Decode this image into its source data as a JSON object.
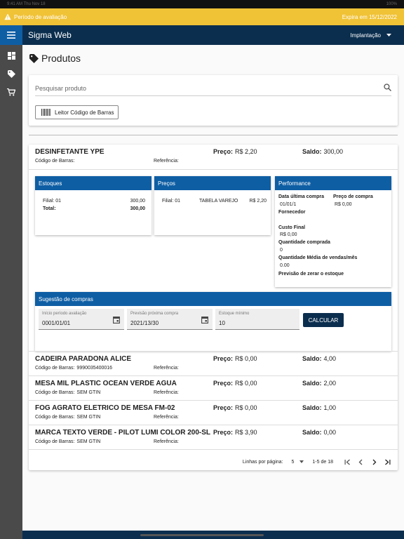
{
  "status_bar": {
    "left": "9:41 AM   Thu Nov 18",
    "right": "100%"
  },
  "trial": {
    "label": "Período de avaliação",
    "expires": "Expira em 15/12/2022"
  },
  "appbar": {
    "title": "Sigma Web",
    "mode": "Implantação"
  },
  "page": {
    "title": "Produtos"
  },
  "search": {
    "placeholder": "Pesquisar produto",
    "barcode_button": "Leitor Código de Barras"
  },
  "labels": {
    "preco": "Preço:",
    "saldo": "Saldo:",
    "codigo_barras": "Código de Barras:",
    "referencia": "Referência:"
  },
  "products": [
    {
      "name": "DESINFETANTE YPE",
      "price": "R$ 2,20",
      "saldo": "300,00",
      "barcode": ""
    },
    {
      "name": "CADEIRA PARADONA ALICE",
      "price": "R$ 0,00",
      "saldo": "4,00",
      "barcode": "9990035400016"
    },
    {
      "name": "MESA MIL PLASTIC OCEAN VERDE AGUA",
      "price": "R$ 0,00",
      "saldo": "2,00",
      "barcode": "SEM GTIN"
    },
    {
      "name": "FOG AGRATO ELETRICO DE MESA FM-02",
      "price": "R$ 0,00",
      "saldo": "1,00",
      "barcode": "SEM GTIN"
    },
    {
      "name": "MARCA TEXTO VERDE - PILOT LUMI COLOR 200-SL",
      "price": "R$ 3,90",
      "saldo": "0,00",
      "barcode": "SEM GTIN"
    }
  ],
  "estoques": {
    "title": "Estoques",
    "filial": "Filial: 01",
    "filial_value": "300,00",
    "total_label": "Total:",
    "total_value": "300,00"
  },
  "precos": {
    "title": "Preços",
    "filial": "Filial: 01",
    "tabela": "TABELA VAREJO",
    "value": "R$ 2,20"
  },
  "performance": {
    "title": "Performance",
    "data_ultima_compra_label": "Data última compra",
    "data_ultima_compra": "01/01/1",
    "preco_compra_label": "Preço de compra",
    "preco_compra": "R$ 0,00",
    "fornecedor_label": "Fornecedor",
    "custo_final_label": "Custo Final",
    "custo_final": "R$ 0,00",
    "qtd_comprada_label": "Quantidade comprada",
    "qtd_comprada": "0",
    "qtd_media_label": "Quantidade Média de vendas/mês",
    "qtd_media": "0.00",
    "previsao_label": "Previsão de zerar o estoque"
  },
  "sugestao": {
    "title": "Sugestão de compras",
    "inicio_label": "Início período avaliação",
    "inicio_value": "0001/01/01",
    "previsao_label": "Previsão próxima compra",
    "previsao_value": "2021/13/30",
    "estoque_label": "Estoque mínimo",
    "estoque_value": "10",
    "calc_button": "CALCULAR"
  },
  "pagination": {
    "rows_label": "Linhas por página:",
    "rows_value": "5",
    "range": "1-5 de 18"
  },
  "colors": {
    "appbar": "#0b2e4e",
    "accent": "#0e5ea4",
    "trial": "#f0c236"
  }
}
